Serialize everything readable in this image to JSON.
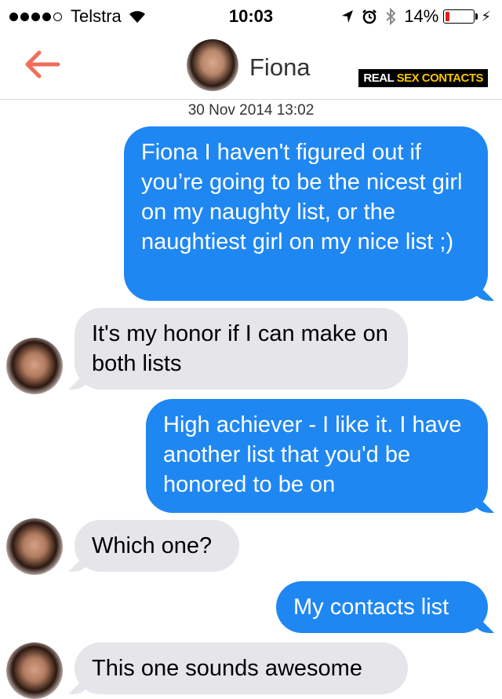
{
  "status_bar": {
    "carrier": "Telstra",
    "time": "10:03",
    "battery_percent": "14%",
    "battery_level": 0.14
  },
  "nav": {
    "contact_name": "Fiona",
    "watermark_part1": "REAL ",
    "watermark_part2": "SEX CONTACTS"
  },
  "conversation": {
    "timestamp": "30 Nov 2014 13:02",
    "messages": [
      {
        "direction": "outgoing",
        "text": "Fiona I haven't figured out if you’re going to be the nicest girl on my naughty list, or the naughtiest girl on my nice list ;)"
      },
      {
        "direction": "incoming",
        "text": "It's my honor if I can make on both lists"
      },
      {
        "direction": "outgoing",
        "text": "High achiever - I like it. I have another list that you'd be honored to be on"
      },
      {
        "direction": "incoming",
        "text": "Which one?"
      },
      {
        "direction": "outgoing",
        "text": "My contacts list"
      },
      {
        "direction": "incoming",
        "text": "This one sounds awesome"
      }
    ]
  },
  "colors": {
    "outgoing_bubble": "#1f87f2",
    "incoming_bubble": "#e5e5ea",
    "back_arrow": "#f26d5b"
  },
  "icons": [
    "signal-dots-icon",
    "wifi-icon",
    "location-arrow-icon",
    "alarm-icon",
    "bluetooth-icon",
    "battery-icon",
    "charging-bolt-icon",
    "back-arrow-icon"
  ]
}
